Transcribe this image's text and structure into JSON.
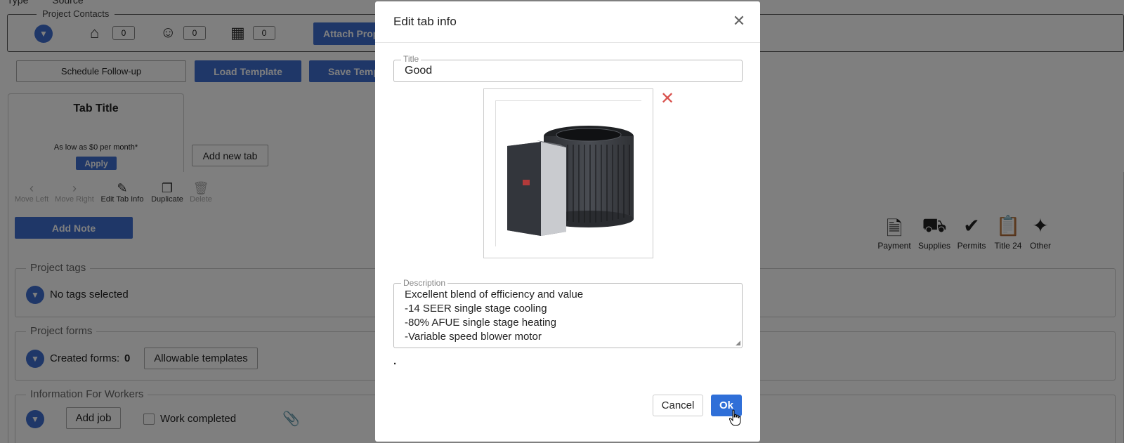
{
  "background": {
    "top_labels": [
      "Type",
      "Source"
    ],
    "contacts": {
      "legend": "Project Contacts",
      "counts": [
        "0",
        "0",
        "0"
      ],
      "attach_label": "Attach Prop"
    },
    "actions": {
      "schedule": "Schedule Follow-up",
      "load_template": "Load Template",
      "save_template": "Save Temp"
    },
    "tab": {
      "title": "Tab Title",
      "subtitle": "As low as $0 per month*",
      "apply": "Apply",
      "add_new_tab": "Add new tab"
    },
    "toolbar": {
      "move_left": "Move Left",
      "move_right": "Move Right",
      "edit_tab_info": "Edit Tab Info",
      "duplicate": "Duplicate",
      "delete": "Delete"
    },
    "add_note": "Add Note",
    "right_icons": {
      "payment": "Payment",
      "supplies": "Supplies",
      "permits": "Permits",
      "title24": "Title 24",
      "other": "Other"
    },
    "project_tags": {
      "legend": "Project tags",
      "text": "No tags selected"
    },
    "project_forms": {
      "legend": "Project forms",
      "created_label": "Created forms:",
      "created_count": "0",
      "allowable": "Allowable templates"
    },
    "workers": {
      "legend": "Information For Workers",
      "add_job": "Add job",
      "work_completed": "Work completed"
    }
  },
  "modal": {
    "title": "Edit tab info",
    "title_field": {
      "label": "Title",
      "value": "Good"
    },
    "description": {
      "label": "Description",
      "value": "Excellent blend of efficiency and value\n-14 SEER single stage cooling\n-80% AFUE single stage heating\n-Variable speed blower motor"
    },
    "dot": ".",
    "cancel": "Cancel",
    "ok": "Ok"
  },
  "colors": {
    "primary": "#3f6fd1",
    "ok_button": "#2f6fd8",
    "remove": "#d9534f"
  }
}
